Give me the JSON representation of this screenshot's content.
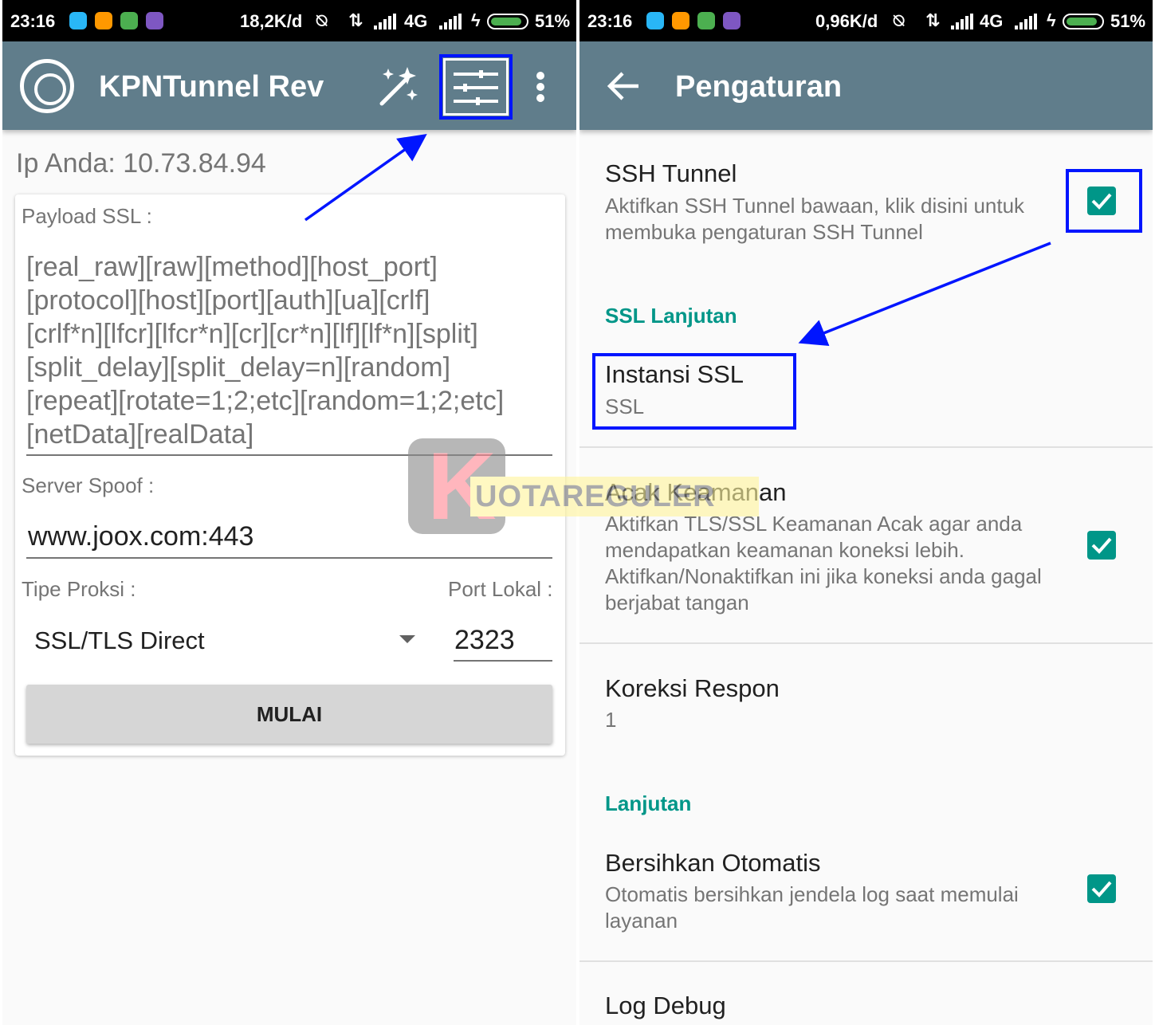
{
  "left": {
    "status": {
      "time": "23:16",
      "rate": "18,2K/d",
      "net": "4G",
      "battery": "51%"
    },
    "app_bar": {
      "title": "KPNTunnel Rev"
    },
    "ip_text": "Ip Anda: 10.73.84.94",
    "payload": {
      "label": "Payload SSL :",
      "value": "[real_raw][raw][method][host_port]\n[protocol][host][port][auth][ua][crlf]\n[crlf*n][lfcr][lfcr*n][cr][cr*n][lf][lf*n][split]\n[split_delay][split_delay=n][random]\n[repeat][rotate=1;2;etc][random=1;2;etc]\n[netData][realData]"
    },
    "server_spoof": {
      "label": "Server Spoof :",
      "value": "www.joox.com:443"
    },
    "proxy_type": {
      "label": "Tipe Proksi :",
      "selected": "SSL/TLS Direct"
    },
    "local_port": {
      "label": "Port Lokal :",
      "value": "2323"
    },
    "start_label": "MULAI"
  },
  "right": {
    "status": {
      "time": "23:16",
      "rate": "0,96K/d",
      "net": "4G",
      "battery": "51%"
    },
    "app_bar": {
      "title": "Pengaturan"
    },
    "ssh_tunnel": {
      "title": "SSH Tunnel",
      "summary": "Aktifkan SSH Tunnel bawaan, klik disini untuk membuka pengaturan SSH Tunnel",
      "checked": true
    },
    "category_ssl": "SSL Lanjutan",
    "ssl_instance": {
      "title": "Instansi SSL",
      "summary": "SSL"
    },
    "random_security": {
      "title": "Acak Keamanan",
      "summary": "Aktifkan TLS/SSL Keamanan Acak agar anda mendapatkan keamanan koneksi lebih. Aktifkan/Nonaktifkan ini jika koneksi anda gagal berjabat tangan",
      "checked": true
    },
    "response_correction": {
      "title": "Koreksi Respon",
      "summary": "1"
    },
    "category_advanced": "Lanjutan",
    "auto_clear": {
      "title": "Bersihkan Otomatis",
      "summary": "Otomatis bersihkan jendela log saat memulai layanan",
      "checked": true
    },
    "log_debug": {
      "title": "Log Debug"
    }
  },
  "watermark": "UOTAREGULER",
  "colors": {
    "app_bar": "#607d8b",
    "accent": "#009688",
    "highlight": "#0015ff",
    "status_bar": "#000000"
  }
}
